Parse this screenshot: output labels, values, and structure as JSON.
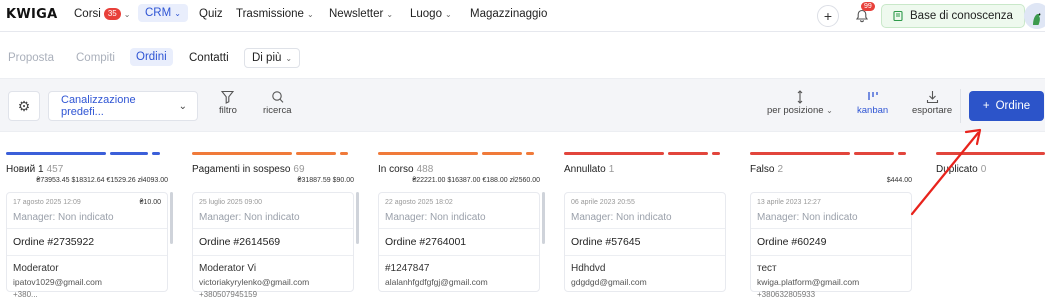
{
  "topbar": {
    "logo": "KWIGA",
    "nav": [
      {
        "label": "Corsi",
        "badge": "35",
        "chevron": true
      },
      {
        "label": "CRM",
        "chevron": true,
        "active": true
      },
      {
        "label": "Quiz"
      },
      {
        "label": "Trasmissione",
        "chevron": true
      },
      {
        "label": "Newsletter",
        "chevron": true
      },
      {
        "label": "Luogo",
        "chevron": true
      },
      {
        "label": "Magazzinaggio"
      }
    ],
    "plus_icon": "+",
    "bell_badge": "99",
    "knowledge_base_label": "Base di conoscenza"
  },
  "subnav": {
    "items": [
      "Proposta",
      "Compiti",
      "Ordini",
      "Contatti",
      "Di più"
    ],
    "active": "Ordini"
  },
  "toolbar": {
    "pipeline_label": "Canalizzazione predefi...",
    "filter_label": "filtro",
    "search_label": "ricerca",
    "sort_label": "per posizione",
    "kanban_label": "kanban",
    "export_label": "esportare",
    "add_label": "Ordine"
  },
  "columns": [
    {
      "title": "Новий 1",
      "count": "457",
      "sum": "₴73953.45 $18312.64 €1529.26 zł4093.00",
      "bar_colors": [
        "#3b5fd9",
        "#3b5fd9",
        "#3b5fd9"
      ],
      "card": {
        "date": "17 agosto 2025 12:09",
        "amount": "₴10.00",
        "manager": "Manager: Non indicato",
        "order": "Ordine #2735922",
        "name": "Moderator",
        "email": "ipatov1029@gmail.com",
        "phone": "+380..."
      }
    },
    {
      "title": "Pagamenti in sospeso",
      "count": "69",
      "sum": "₴31887.59 $90.00",
      "bar_colors": [
        "#f07a3a",
        "#f07a3a",
        "#f07a3a"
      ],
      "card": {
        "date": "25 luglio 2025 09:00",
        "amount": "",
        "manager": "Manager: Non indicato",
        "order": "Ordine #2614569",
        "name": "Moderator Vi",
        "email": "victoriakyrylenko@gmail.com",
        "phone": "+380507945159"
      }
    },
    {
      "title": "In corso",
      "count": "488",
      "sum": "₴22221.00 $16387.00 €188.00 zł2560.00",
      "bar_colors": [
        "#f07a3a",
        "#f07a3a",
        "#f07a3a"
      ],
      "card": {
        "date": "22 agosto 2025 18:02",
        "amount": "",
        "manager": "Manager: Non indicato",
        "order": "Ordine #2764001",
        "name": "#1247847",
        "email": "alalanhfgdfgfgj@gmail.com",
        "phone": ""
      }
    },
    {
      "title": "Annullato",
      "count": "1",
      "sum": "",
      "bar_colors": [
        "#e2453c",
        "#e2453c",
        "#e2453c"
      ],
      "card": {
        "date": "06 aprile 2023 20:55",
        "amount": "",
        "manager": "Manager: Non indicato",
        "order": "Ordine #57645",
        "name": "Hdhdvd",
        "email": "gdgdgd@gmail.com",
        "phone": ""
      }
    },
    {
      "title": "Falso",
      "count": "2",
      "sum": "$444.00",
      "bar_colors": [
        "#e2453c",
        "#e2453c",
        "#e2453c"
      ],
      "card": {
        "date": "13 aprile 2023 12:27",
        "amount": "",
        "manager": "Manager: Non indicato",
        "order": "Ordine #60249",
        "name": "тест",
        "email": "kwiga.platform@gmail.com",
        "phone": "+380632805933"
      }
    },
    {
      "title": "Duplicato",
      "count": "0",
      "sum": "",
      "bar_colors": [
        "#e2453c"
      ],
      "card": null
    }
  ],
  "colors": {
    "accent": "#2c54c9",
    "arrow": "#e8231c"
  }
}
